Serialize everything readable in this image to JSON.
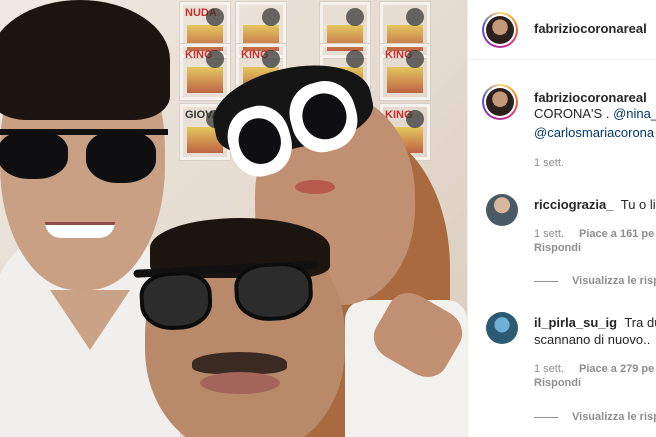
{
  "post": {
    "username": "fabriziocoronareal",
    "caption_user": "fabriziocoronareal",
    "caption_line1": "CORONA'S . ",
    "caption_mention1": "@nina_",
    "caption_mention2": "@carlosmariacorona",
    "timestamp": "1 sett.",
    "photo_poster_labels": [
      "NUDA",
      "KING",
      "KING",
      "KING",
      "GIOVAN",
      "KING"
    ]
  },
  "comments": [
    {
      "username": "ricciograzia_",
      "text": "Tu o li",
      "time": "1 sett.",
      "likes": "Piace a 161 pe",
      "reply": "Rispondi",
      "view_replies": "Visualizza le risp"
    },
    {
      "username": "il_pirla_su_ig",
      "text_line1": "Tra du",
      "text_line2": "scannano di nuovo..",
      "time": "1 sett.",
      "likes": "Piace a 279 pe",
      "reply": "Rispondi",
      "view_replies": "Visualizza le risp"
    }
  ],
  "colors": {
    "link": "#00376b",
    "muted": "#8e8e8e",
    "text": "#262626",
    "border": "#efefef"
  }
}
